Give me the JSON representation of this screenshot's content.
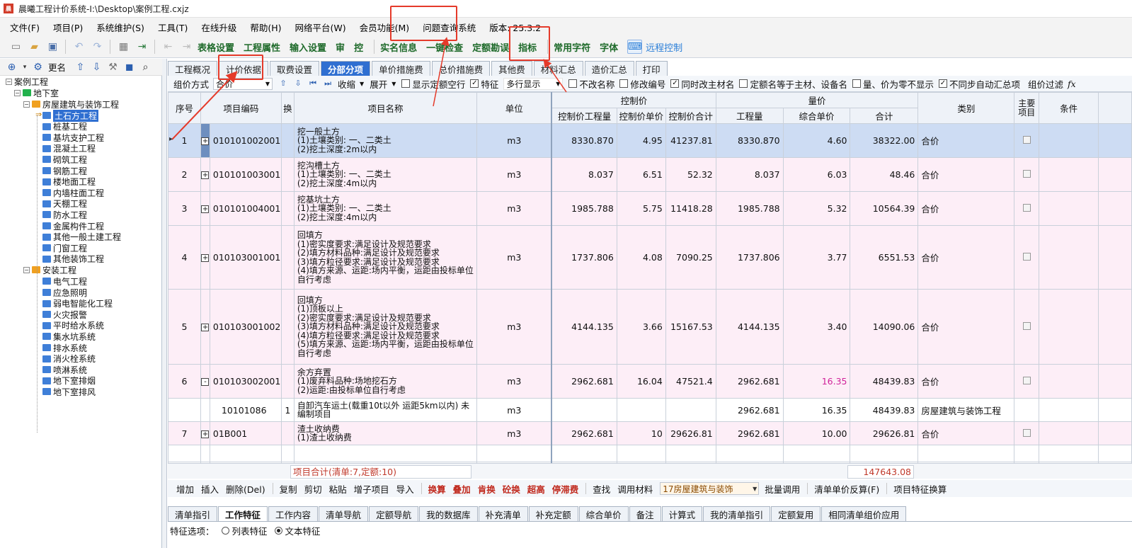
{
  "window": {
    "title": "晨曦工程计价系统-I:\\Desktop\\案例工程.cxjz",
    "icon": "app-logo-icon"
  },
  "menu": [
    "文件(F)",
    "项目(P)",
    "系统维护(S)",
    "工具(T)",
    "在线升级",
    "帮助(H)",
    "网络平台(W)",
    "会员功能(M)",
    "问题查询系统",
    "版本: 25.3.2"
  ],
  "toolbar": {
    "icons": [
      "new-file-icon",
      "open-folder-icon",
      "save-icon",
      "undo-icon",
      "redo-icon",
      "calculator-icon",
      "export-icon",
      "back-icon",
      "forward-icon"
    ],
    "buttons": [
      "表格设置",
      "工程属性",
      "输入设置",
      "审",
      "控",
      "实名信息",
      "一键检查",
      "定额勘误",
      "指标",
      "常用字符",
      "字体"
    ],
    "remote": "远程控制"
  },
  "left_tools": {
    "icons": [
      "add-icon",
      "dropdown-icon",
      "settings-icon"
    ],
    "rename": "更名",
    "icons2": [
      "up-arrow-icon",
      "down-arrow-icon",
      "hammer-icon",
      "bookmark-icon",
      "search-icon"
    ]
  },
  "tree": {
    "root": "案例工程",
    "level1": "地下室",
    "groups": [
      {
        "name": "房屋建筑与装饰工程",
        "items": [
          "土石方工程",
          "桩基工程",
          "基坑支护工程",
          "混凝土工程",
          "砌筑工程",
          "钢筋工程",
          "楼地面工程",
          "内墙柱面工程",
          "天棚工程",
          "防水工程",
          "金属构件工程",
          "其他一般土建工程",
          "门窗工程",
          "其他装饰工程"
        ]
      },
      {
        "name": "安装工程",
        "items": [
          "电气工程",
          "应急照明",
          "弱电智能化工程",
          "火灾报警",
          "平时给水系统",
          "集水坑系统",
          "排水系统",
          "消火栓系统",
          "喷淋系统",
          "地下室排烟",
          "地下室排风"
        ]
      }
    ],
    "selected": "土石方工程"
  },
  "tabs": {
    "items": [
      "工程概况",
      "计价依据",
      "取费设置",
      "分部分项",
      "单价措施费",
      "总价措施费",
      "其他费",
      "材料汇总",
      "造价汇总",
      "打印"
    ],
    "active": "分部分项"
  },
  "options": {
    "pricing_label": "组价方式",
    "pricing_value": "合价",
    "collapse": "收缩",
    "expand": "展开",
    "show_empty": "显示定额空行",
    "feature": "特征",
    "multiline": "多行显示",
    "no_rename": "不改名称",
    "modify_code": "修改编号",
    "sync_material": "同时改主材名",
    "same_name": "定额名等于主材、设备名",
    "zero_hide": "量、价为零不显示",
    "no_sync_summary": "不同步自动汇总项",
    "group_filter": "组价过滤",
    "fx": "fx"
  },
  "table": {
    "headers": {
      "seq": "序号",
      "code": "项目编码",
      "swap": "换",
      "name": "项目名称",
      "unit": "单位",
      "ctrl_group": "控制价",
      "ctrl_qty": "控制价工程量",
      "ctrl_price": "控制价单价",
      "ctrl_total": "控制价合计",
      "qty_group": "量价",
      "qty": "工程量",
      "unit_price": "综合单价",
      "total": "合计",
      "category": "类别",
      "main": "主要项目",
      "cond": "条件"
    },
    "rows": [
      {
        "seq": "1",
        "code": "010101002001",
        "name": [
          "挖一般土方",
          "(1)土壤类别: 一、二类土",
          "(2)挖土深度:2m以内"
        ],
        "unit": "m3",
        "ctrl_qty": "8330.870",
        "ctrl_price": "4.95",
        "ctrl_total": "41237.81",
        "qty": "8330.870",
        "unit_price": "4.60",
        "total": "38322.00",
        "category": "合价",
        "style": "selected",
        "exp": "+"
      },
      {
        "seq": "2",
        "code": "010101003001",
        "name": [
          "挖沟槽土方",
          "(1)土壤类别: 一、二类土",
          "(2)挖土深度:4m以内"
        ],
        "unit": "m3",
        "ctrl_qty": "8.037",
        "ctrl_price": "6.51",
        "ctrl_total": "52.32",
        "qty": "8.037",
        "unit_price": "6.03",
        "total": "48.46",
        "category": "合价",
        "style": "pink",
        "exp": "+"
      },
      {
        "seq": "3",
        "code": "010101004001",
        "name": [
          "挖基坑土方",
          "(1)土壤类别: 一、二类土",
          "(2)挖土深度:4m以内"
        ],
        "unit": "m3",
        "ctrl_qty": "1985.788",
        "ctrl_price": "5.75",
        "ctrl_total": "11418.28",
        "qty": "1985.788",
        "unit_price": "5.32",
        "total": "10564.39",
        "category": "合价",
        "style": "pink",
        "exp": "+"
      },
      {
        "seq": "4",
        "code": "010103001001",
        "name": [
          "回填方",
          "(1)密实度要求:满足设计及规范要求",
          "(2)填方材料品种:满足设计及规范要求",
          "(3)填方粒径要求:满足设计及规范要求",
          "(4)填方来源、运距:场内平衡，运距由投标单位自行考虑"
        ],
        "unit": "m3",
        "ctrl_qty": "1737.806",
        "ctrl_price": "4.08",
        "ctrl_total": "7090.25",
        "qty": "1737.806",
        "unit_price": "3.77",
        "total": "6551.53",
        "category": "合价",
        "style": "pink",
        "exp": "+"
      },
      {
        "seq": "5",
        "code": "010103001002",
        "name": [
          "回填方",
          "(1)顶板以上",
          "(2)密实度要求:满足设计及规范要求",
          "(3)填方材料品种:满足设计及规范要求",
          "(4)填方粒径要求:满足设计及规范要求",
          "(5)填方来源、运距:场内平衡，运距由投标单位自行考虑"
        ],
        "unit": "m3",
        "ctrl_qty": "4144.135",
        "ctrl_price": "3.66",
        "ctrl_total": "15167.53",
        "qty": "4144.135",
        "unit_price": "3.40",
        "total": "14090.06",
        "category": "合价",
        "style": "pink",
        "exp": "+"
      },
      {
        "seq": "6",
        "code": "010103002001",
        "name": [
          "余方弃置",
          "(1)废弃料品种:场地挖石方",
          "(2)运距:由投标单位自行考虑"
        ],
        "unit": "m3",
        "ctrl_qty": "2962.681",
        "ctrl_price": "16.04",
        "ctrl_total": "47521.4",
        "qty": "2962.681",
        "unit_price": "16.35",
        "total": "48439.83",
        "category": "合价",
        "style": "pink",
        "exp": "-",
        "mag": true
      },
      {
        "seq": "",
        "code": "10101086",
        "swap": "1",
        "name": [
          "自卸汽车运土(载重10t以外 运距5km以内) 未编制项目"
        ],
        "unit": "m3",
        "ctrl_qty": "",
        "ctrl_price": "",
        "ctrl_total": "",
        "qty": "2962.681",
        "unit_price": "16.35",
        "total": "48439.83",
        "category": "房屋建筑与装饰工程",
        "style": "sub",
        "exp": ""
      },
      {
        "seq": "7",
        "code": "01B001",
        "name": [
          "渣土收纳费",
          "(1)渣土收纳费"
        ],
        "unit": "m3",
        "ctrl_qty": "2962.681",
        "ctrl_price": "10",
        "ctrl_total": "29626.81",
        "qty": "2962.681",
        "unit_price": "10.00",
        "total": "29626.81",
        "category": "合价",
        "style": "pink",
        "exp": "+"
      }
    ]
  },
  "summary": {
    "label": "项目合计(清单:7,定额:10)",
    "total": "147643.08"
  },
  "actions": {
    "plain1": [
      "增加",
      "插入",
      "删除(Del)",
      "复制",
      "剪切",
      "粘贴",
      "增子项目",
      "导入"
    ],
    "red": [
      "换算",
      "叠加",
      "肯换",
      "砼换",
      "超高",
      "停滞费"
    ],
    "plain2": [
      "查找",
      "调用材料"
    ],
    "select": "17房屋建筑与装饰",
    "plain3": [
      "批量调用",
      "清单单价反算(F)",
      "项目特征换算"
    ]
  },
  "bottom_tabs": {
    "items": [
      "清单指引",
      "工作特征",
      "工作内容",
      "清单导航",
      "定额导航",
      "我的数据库",
      "补充清单",
      "补充定额",
      "综合单价",
      "备注",
      "计算式",
      "我的清单指引",
      "定额复用",
      "相同清单组价应用"
    ],
    "active": "工作特征"
  },
  "feature_opts": {
    "label": "特征选项：",
    "list": "列表特征",
    "text": "文本特征"
  },
  "colors": {
    "accent": "#2f6fd1",
    "selected_row": "#cddcf3",
    "pink_row": "#fdeef7",
    "highlight": "#e53a2a",
    "magenta": "#d0229a"
  }
}
